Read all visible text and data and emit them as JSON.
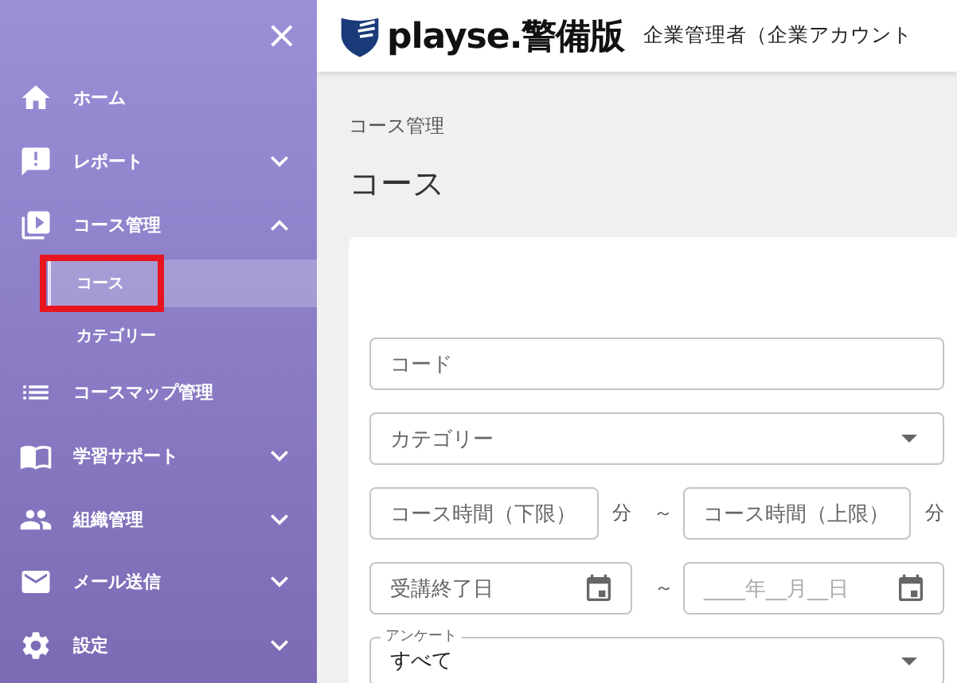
{
  "sidebar": {
    "close": "×",
    "items": [
      {
        "label": "ホーム"
      },
      {
        "label": "レポート",
        "expanded": false
      },
      {
        "label": "コース管理",
        "expanded": true,
        "children": [
          {
            "label": "コース",
            "selected": true,
            "highlighted": true
          },
          {
            "label": "カテゴリー",
            "selected": false,
            "highlighted": false
          }
        ]
      },
      {
        "label": "コースマップ管理"
      },
      {
        "label": "学習サポート",
        "expanded": false
      },
      {
        "label": "組織管理",
        "expanded": false
      },
      {
        "label": "メール送信",
        "expanded": false
      },
      {
        "label": "設定",
        "expanded": false
      }
    ]
  },
  "header": {
    "logo": "playse.警備版",
    "user": "企業管理者（企業アカウント"
  },
  "breadcrumb": "コース管理",
  "title": "コース",
  "form": [
    {
      "kind": "text",
      "placeholder": "コード"
    },
    {
      "kind": "select",
      "placeholder": "カテゴリー"
    },
    {
      "kind": "range",
      "from": {
        "placeholder": "コース時間（下限）",
        "unit": "分"
      },
      "sep": "～",
      "to": {
        "placeholder": "コース時間（上限）",
        "unit": "分"
      }
    },
    {
      "kind": "daterange",
      "from": {
        "placeholder": "受講終了日"
      },
      "sep": "～",
      "to": {
        "placeholder": "____年__月__日"
      }
    },
    {
      "kind": "outlined-select",
      "label": "アンケート",
      "value": "すべて"
    }
  ]
}
